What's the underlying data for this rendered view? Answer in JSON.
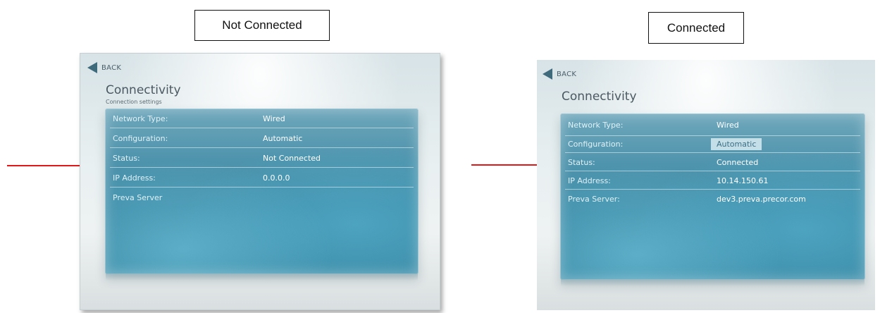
{
  "captions": {
    "left": "Not Connected",
    "right": "Connected"
  },
  "colors": {
    "arrow": "#e01818",
    "panel": "#3d8aa5",
    "back_arrow": "#3f6a7c"
  },
  "left_screen": {
    "back_label": "BACK",
    "title": "Connectivity",
    "subtitle": "Connection settings",
    "rows": [
      {
        "label": "Network Type:",
        "value": "Wired"
      },
      {
        "label": "Configuration:",
        "value": "Automatic"
      },
      {
        "label": "Status:",
        "value": "Not Connected"
      },
      {
        "label": "IP Address:",
        "value": "0.0.0.0"
      },
      {
        "label": "Preva Server",
        "value": ""
      }
    ]
  },
  "right_screen": {
    "back_label": "BACK",
    "title": "Connectivity",
    "rows": [
      {
        "label": "Network Type:",
        "value": "Wired"
      },
      {
        "label": "Configuration:",
        "value": "Automatic"
      },
      {
        "label": "Status:",
        "value": "Connected"
      },
      {
        "label": "IP Address:",
        "value": "10.14.150.61"
      },
      {
        "label": "Preva Server:",
        "value": "dev3.preva.precor.com"
      }
    ]
  }
}
